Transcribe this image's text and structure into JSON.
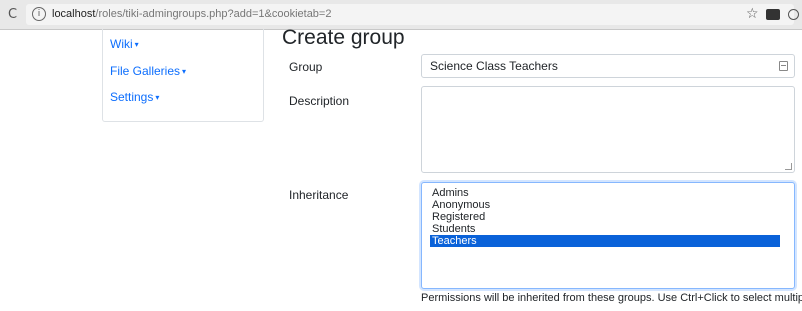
{
  "browser": {
    "url_host": "localhost",
    "url_path": "/roles/tiki-admingroups.php?add=1&cookietab=2"
  },
  "sidebar": {
    "items": [
      {
        "label": "Wiki"
      },
      {
        "label": "File Galleries"
      },
      {
        "label": "Settings"
      }
    ]
  },
  "main": {
    "title": "Create group",
    "group": {
      "label": "Group",
      "value": "Science Class Teachers"
    },
    "description": {
      "label": "Description",
      "value": ""
    },
    "inheritance": {
      "label": "Inheritance",
      "options": [
        "Admins",
        "Anonymous",
        "Registered",
        "Students",
        "Teachers"
      ],
      "selected": "Teachers",
      "help": "Permissions will be inherited from these groups. Use Ctrl+Click to select multiple"
    }
  },
  "colors": {
    "link": "#0d6efd",
    "selection": "#0a62d9"
  },
  "icons": [
    "reload-icon",
    "info-icon",
    "star-icon",
    "extension-icon",
    "profile-icon",
    "field-menu-icon"
  ]
}
